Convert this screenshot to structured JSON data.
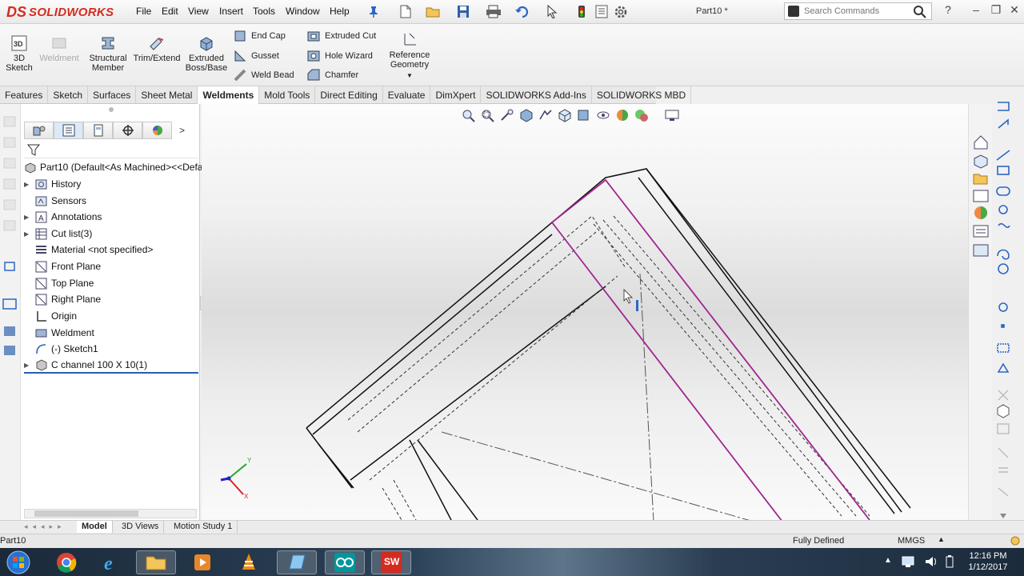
{
  "app": {
    "logo_mark": "DS",
    "logo_text": "SOLIDWORKS",
    "document_title": "Part10 *"
  },
  "menu": [
    "File",
    "Edit",
    "View",
    "Insert",
    "Tools",
    "Window",
    "Help"
  ],
  "search": {
    "placeholder": "Search Commands"
  },
  "window_buttons": {
    "help": "?",
    "minimize": "–",
    "restore": "❐",
    "close": "✕"
  },
  "command_manager": {
    "big_buttons": [
      {
        "label": "3D\nSketch",
        "icon": "3d-sketch-icon"
      },
      {
        "label": "Weldment",
        "icon": "weldment-icon",
        "disabled": true
      },
      {
        "label": "Structural\nMember",
        "icon": "structural-member-icon"
      },
      {
        "label": "Trim/Extend",
        "icon": "trim-extend-icon"
      },
      {
        "label": "Extruded\nBoss/Base",
        "icon": "extruded-boss-icon"
      }
    ],
    "col1": [
      "End Cap",
      "Gusset",
      "Weld Bead"
    ],
    "col2": [
      "Extruded Cut",
      "Hole Wizard",
      "Chamfer"
    ],
    "reference_geometry": "Reference\nGeometry"
  },
  "tabs": [
    "Features",
    "Sketch",
    "Surfaces",
    "Sheet Metal",
    "Weldments",
    "Mold Tools",
    "Direct Editing",
    "Evaluate",
    "DimXpert",
    "SOLIDWORKS Add-Ins",
    "SOLIDWORKS MBD"
  ],
  "active_tab": "Weldments",
  "feature_tree": {
    "root": "Part10  (Default<As Machined><<Defau",
    "items": [
      {
        "label": "History",
        "expand": true,
        "icon": "history-icon"
      },
      {
        "label": "Sensors",
        "expand": false,
        "icon": "sensors-icon"
      },
      {
        "label": "Annotations",
        "expand": true,
        "icon": "annotations-icon"
      },
      {
        "label": "Cut list(3)",
        "expand": true,
        "icon": "cut-list-icon"
      },
      {
        "label": "Material <not specified>",
        "expand": false,
        "icon": "material-icon"
      },
      {
        "label": "Front Plane",
        "expand": false,
        "icon": "plane-icon"
      },
      {
        "label": "Top Plane",
        "expand": false,
        "icon": "plane-icon"
      },
      {
        "label": "Right Plane",
        "expand": false,
        "icon": "plane-icon"
      },
      {
        "label": "Origin",
        "expand": false,
        "icon": "origin-icon"
      },
      {
        "label": "Weldment",
        "expand": false,
        "icon": "weldment-icon"
      },
      {
        "label": "(-) Sketch1",
        "expand": false,
        "icon": "sketch-icon"
      },
      {
        "label": "C channel 100 X 10(1)",
        "expand": true,
        "icon": "structural-member-icon"
      }
    ]
  },
  "bottom_tabs": [
    "Model",
    "3D Views",
    "Motion Study 1"
  ],
  "active_bottom_tab": "Model",
  "status": {
    "left": "Part10",
    "state": "Fully Defined",
    "units": "MMGS"
  },
  "axis_labels": {
    "x": "X",
    "y": "Y"
  },
  "taskbar": {
    "time": "12:16 PM",
    "date": "1/12/2017"
  },
  "colors": {
    "accent_red": "#d52b1e",
    "selection_edge": "#a0268f",
    "active_underline": "#2a5db0"
  }
}
